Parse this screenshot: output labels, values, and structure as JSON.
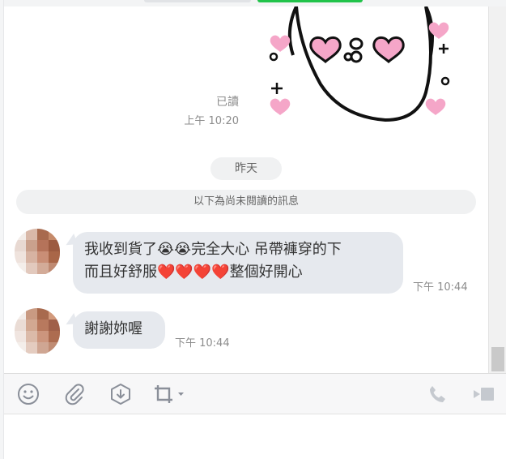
{
  "messages": {
    "sticker": {
      "read_status": "已讀",
      "time": "上午 10:20"
    },
    "date_divider": "昨天",
    "unread_divider": "以下為尚未閱讀的訊息",
    "incoming": [
      {
        "text_line1": "我收到貨了😭😭完全大心 吊帶褲穿的下",
        "text_line2": "而且好舒服❤️❤️❤️❤️整個好開心",
        "time": "下午 10:44"
      },
      {
        "text_line1": "謝謝妳喔",
        "time": "下午 10:44"
      }
    ]
  },
  "toolbar": {
    "icons": [
      "emoji-icon",
      "attach-icon",
      "keep-icon",
      "screenshot-icon",
      "call-icon",
      "video-call-icon"
    ]
  },
  "colors": {
    "bubble": "#e6e9ee",
    "accent_green": "#21c34a",
    "sticker_pink": "#f5a6c8"
  }
}
